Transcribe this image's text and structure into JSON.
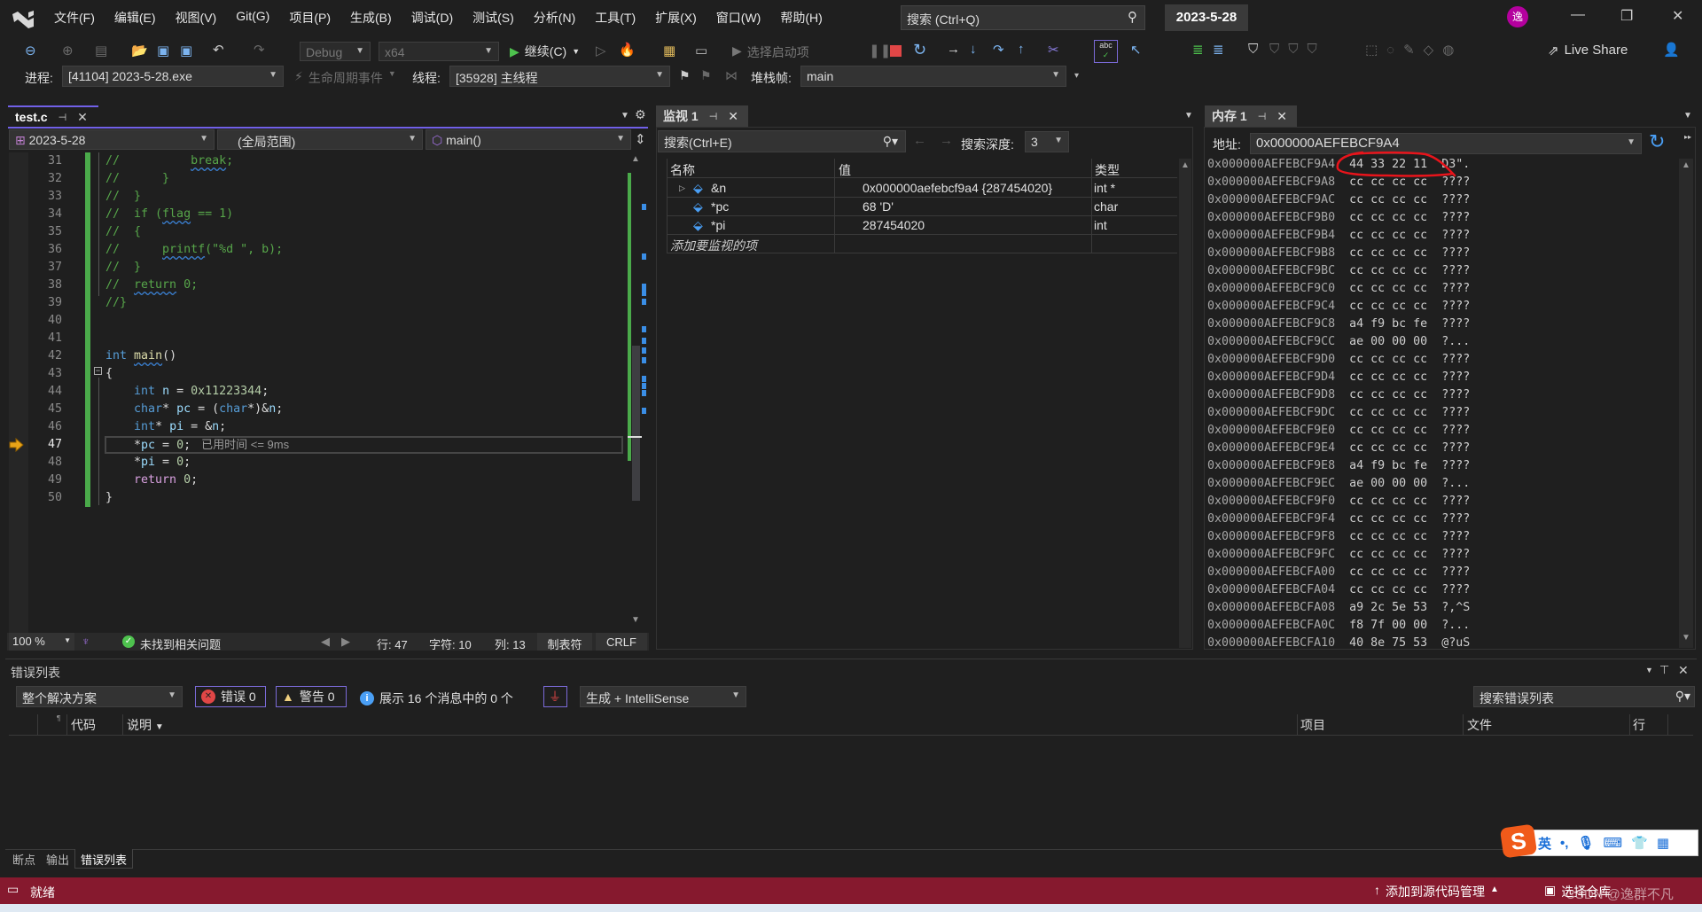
{
  "title_bar": {
    "menus": [
      "文件(F)",
      "编辑(E)",
      "视图(V)",
      "Git(G)",
      "项目(P)",
      "生成(B)",
      "调试(D)",
      "测试(S)",
      "分析(N)",
      "工具(T)",
      "扩展(X)",
      "窗口(W)",
      "帮助(H)"
    ],
    "search_placeholder": "搜索 (Ctrl+Q)",
    "solution_name": "2023-5-28",
    "avatar_initial": "逸"
  },
  "toolbar": {
    "config": "Debug",
    "platform": "x64",
    "continue_label": "继续(C)",
    "startup_label": "选择启动项",
    "live_share": "Live Share"
  },
  "debug_location": {
    "process_label": "进程:",
    "process": "[41104] 2023-5-28.exe",
    "lifecycle": "生命周期事件",
    "thread_label": "线程:",
    "thread": "[35928] 主线程",
    "stack_label": "堆栈帧:",
    "stack": "main"
  },
  "editor": {
    "tab": "test.c",
    "nav_project": "2023-5-28",
    "nav_scope": "(全局范围)",
    "nav_member": "main()",
    "current_line": 47,
    "lines": [
      {
        "n": "31",
        "tokens": [
          {
            "t": "//          ",
            "c": "cm"
          },
          {
            "t": "break",
            "c": "cm sq"
          },
          {
            "t": ";",
            "c": "cm"
          }
        ]
      },
      {
        "n": "32",
        "tokens": [
          {
            "t": "//      }",
            "c": "cm"
          }
        ]
      },
      {
        "n": "33",
        "tokens": [
          {
            "t": "//  }",
            "c": "cm"
          }
        ]
      },
      {
        "n": "34",
        "tokens": [
          {
            "t": "//  if (",
            "c": "cm"
          },
          {
            "t": "flag",
            "c": "cm sq"
          },
          {
            "t": " == 1)",
            "c": "cm"
          }
        ]
      },
      {
        "n": "35",
        "tokens": [
          {
            "t": "//  {",
            "c": "cm"
          }
        ]
      },
      {
        "n": "36",
        "tokens": [
          {
            "t": "//      ",
            "c": "cm"
          },
          {
            "t": "printf",
            "c": "cm sq"
          },
          {
            "t": "(\"%d \", b);",
            "c": "cm"
          }
        ]
      },
      {
        "n": "37",
        "tokens": [
          {
            "t": "//  }",
            "c": "cm"
          }
        ]
      },
      {
        "n": "38",
        "tokens": [
          {
            "t": "//  ",
            "c": "cm"
          },
          {
            "t": "return",
            "c": "cm sq"
          },
          {
            "t": " 0;",
            "c": "cm"
          }
        ]
      },
      {
        "n": "39",
        "tokens": [
          {
            "t": "//}",
            "c": "cm"
          }
        ]
      },
      {
        "n": "40",
        "tokens": []
      },
      {
        "n": "41",
        "tokens": []
      },
      {
        "n": "42",
        "tokens": [
          {
            "t": "int",
            "c": "kw"
          },
          {
            "t": " ",
            "c": "p"
          },
          {
            "t": "main",
            "c": "fn sq"
          },
          {
            "t": "()",
            "c": "p"
          }
        ]
      },
      {
        "n": "43",
        "tokens": [
          {
            "t": "{",
            "c": "p"
          }
        ]
      },
      {
        "n": "44",
        "tokens": [
          {
            "t": "    ",
            "c": "p"
          },
          {
            "t": "int",
            "c": "kw"
          },
          {
            "t": " ",
            "c": "p"
          },
          {
            "t": "n",
            "c": "id"
          },
          {
            "t": " = ",
            "c": "p"
          },
          {
            "t": "0x11223344",
            "c": "num"
          },
          {
            "t": ";",
            "c": "p"
          }
        ]
      },
      {
        "n": "45",
        "tokens": [
          {
            "t": "    ",
            "c": "p"
          },
          {
            "t": "char",
            "c": "kw"
          },
          {
            "t": "* ",
            "c": "p"
          },
          {
            "t": "pc",
            "c": "id"
          },
          {
            "t": " = (",
            "c": "p"
          },
          {
            "t": "char",
            "c": "kw"
          },
          {
            "t": "*)&",
            "c": "p"
          },
          {
            "t": "n",
            "c": "id"
          },
          {
            "t": ";",
            "c": "p"
          }
        ]
      },
      {
        "n": "46",
        "tokens": [
          {
            "t": "    ",
            "c": "p"
          },
          {
            "t": "int",
            "c": "kw"
          },
          {
            "t": "* ",
            "c": "p"
          },
          {
            "t": "pi",
            "c": "id"
          },
          {
            "t": " = &",
            "c": "p"
          },
          {
            "t": "n",
            "c": "id"
          },
          {
            "t": ";",
            "c": "p"
          }
        ]
      },
      {
        "n": "47",
        "tokens": [
          {
            "t": "    *",
            "c": "p"
          },
          {
            "t": "pc",
            "c": "id"
          },
          {
            "t": " = ",
            "c": "p"
          },
          {
            "t": "0",
            "c": "num"
          },
          {
            "t": ";",
            "c": "p"
          },
          {
            "t": "已用时间 <= 9ms",
            "c": "hint"
          }
        ]
      },
      {
        "n": "48",
        "tokens": [
          {
            "t": "    *",
            "c": "p"
          },
          {
            "t": "pi",
            "c": "id"
          },
          {
            "t": " = ",
            "c": "p"
          },
          {
            "t": "0",
            "c": "num"
          },
          {
            "t": ";",
            "c": "p"
          }
        ]
      },
      {
        "n": "49",
        "tokens": [
          {
            "t": "    ",
            "c": "p"
          },
          {
            "t": "return",
            "c": "ctl"
          },
          {
            "t": " ",
            "c": "p"
          },
          {
            "t": "0",
            "c": "num"
          },
          {
            "t": ";",
            "c": "p"
          }
        ]
      },
      {
        "n": "50",
        "tokens": [
          {
            "t": "}",
            "c": "p"
          }
        ]
      }
    ],
    "status": {
      "zoom": "100 %",
      "issues": "未找到相关问题",
      "line": "行: 47",
      "char": "字符: 10",
      "col": "列: 13",
      "indent": "制表符",
      "eol": "CRLF"
    }
  },
  "watch": {
    "tab": "监视 1",
    "search_placeholder": "搜索(Ctrl+E)",
    "depth_label": "搜索深度:",
    "depth": "3",
    "columns": [
      "名称",
      "值",
      "类型"
    ],
    "rows": [
      {
        "name": "&n",
        "value": "0x000000aefebcf9a4 {287454020}",
        "type": "int *",
        "expandable": true
      },
      {
        "name": "*pc",
        "value": "68 'D'",
        "type": "char",
        "expandable": false
      },
      {
        "name": "*pi",
        "value": "287454020",
        "type": "int",
        "expandable": false
      }
    ],
    "add_item": "添加要监视的项"
  },
  "memory": {
    "tab": "内存 1",
    "address_label": "地址:",
    "address": "0x000000AEFEBCF9A4",
    "annotation_color": "#e8141b",
    "rows": [
      {
        "addr": "0x000000AEFEBCF9A4",
        "bytes": "44 33 22 11",
        "ascii": "D3\"."
      },
      {
        "addr": "0x000000AEFEBCF9A8",
        "bytes": "cc cc cc cc",
        "ascii": "????"
      },
      {
        "addr": "0x000000AEFEBCF9AC",
        "bytes": "cc cc cc cc",
        "ascii": "????"
      },
      {
        "addr": "0x000000AEFEBCF9B0",
        "bytes": "cc cc cc cc",
        "ascii": "????"
      },
      {
        "addr": "0x000000AEFEBCF9B4",
        "bytes": "cc cc cc cc",
        "ascii": "????"
      },
      {
        "addr": "0x000000AEFEBCF9B8",
        "bytes": "cc cc cc cc",
        "ascii": "????"
      },
      {
        "addr": "0x000000AEFEBCF9BC",
        "bytes": "cc cc cc cc",
        "ascii": "????"
      },
      {
        "addr": "0x000000AEFEBCF9C0",
        "bytes": "cc cc cc cc",
        "ascii": "????"
      },
      {
        "addr": "0x000000AEFEBCF9C4",
        "bytes": "cc cc cc cc",
        "ascii": "????"
      },
      {
        "addr": "0x000000AEFEBCF9C8",
        "bytes": "a4 f9 bc fe",
        "ascii": "????"
      },
      {
        "addr": "0x000000AEFEBCF9CC",
        "bytes": "ae 00 00 00",
        "ascii": "?..."
      },
      {
        "addr": "0x000000AEFEBCF9D0",
        "bytes": "cc cc cc cc",
        "ascii": "????"
      },
      {
        "addr": "0x000000AEFEBCF9D4",
        "bytes": "cc cc cc cc",
        "ascii": "????"
      },
      {
        "addr": "0x000000AEFEBCF9D8",
        "bytes": "cc cc cc cc",
        "ascii": "????"
      },
      {
        "addr": "0x000000AEFEBCF9DC",
        "bytes": "cc cc cc cc",
        "ascii": "????"
      },
      {
        "addr": "0x000000AEFEBCF9E0",
        "bytes": "cc cc cc cc",
        "ascii": "????"
      },
      {
        "addr": "0x000000AEFEBCF9E4",
        "bytes": "cc cc cc cc",
        "ascii": "????"
      },
      {
        "addr": "0x000000AEFEBCF9E8",
        "bytes": "a4 f9 bc fe",
        "ascii": "????"
      },
      {
        "addr": "0x000000AEFEBCF9EC",
        "bytes": "ae 00 00 00",
        "ascii": "?..."
      },
      {
        "addr": "0x000000AEFEBCF9F0",
        "bytes": "cc cc cc cc",
        "ascii": "????"
      },
      {
        "addr": "0x000000AEFEBCF9F4",
        "bytes": "cc cc cc cc",
        "ascii": "????"
      },
      {
        "addr": "0x000000AEFEBCF9F8",
        "bytes": "cc cc cc cc",
        "ascii": "????"
      },
      {
        "addr": "0x000000AEFEBCF9FC",
        "bytes": "cc cc cc cc",
        "ascii": "????"
      },
      {
        "addr": "0x000000AEFEBCFA00",
        "bytes": "cc cc cc cc",
        "ascii": "????"
      },
      {
        "addr": "0x000000AEFEBCFA04",
        "bytes": "cc cc cc cc",
        "ascii": "????"
      },
      {
        "addr": "0x000000AEFEBCFA08",
        "bytes": "a9 2c 5e 53",
        "ascii": "?,^S"
      },
      {
        "addr": "0x000000AEFEBCFA0C",
        "bytes": "f8 7f 00 00",
        "ascii": "?..."
      },
      {
        "addr": "0x000000AEFEBCFA10",
        "bytes": "40 8e 75 53",
        "ascii": "@?uS"
      }
    ]
  },
  "error_list": {
    "title": "错误列表",
    "scope": "整个解决方案",
    "errors": "错误 0",
    "warnings": "警告 0",
    "messages": "展示 16 个消息中的 0 个",
    "source": "生成 + IntelliSense",
    "search_placeholder": "搜索错误列表",
    "columns": {
      "code": "代码",
      "desc": "说明",
      "project": "项目",
      "file": "文件",
      "line": "行"
    }
  },
  "bottom_tabs": [
    "断点",
    "输出",
    "错误列表"
  ],
  "ime": {
    "mode": "英"
  },
  "status_bar": {
    "ready": "就绪",
    "add_source_control": "添加到源代码管理",
    "select_repo": "选择仓库",
    "watermark": "CSDN @逸群不凡",
    "color": "#86192e"
  }
}
